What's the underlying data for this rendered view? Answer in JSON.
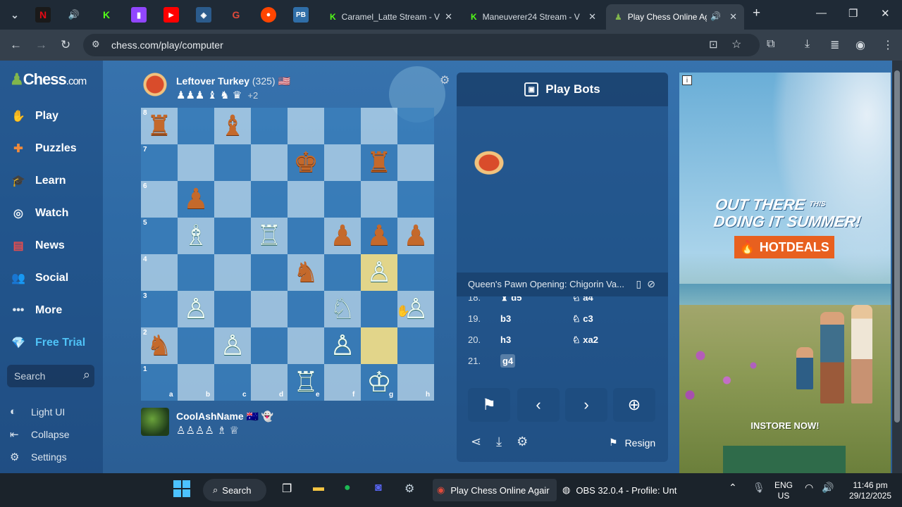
{
  "browser": {
    "tabs": [
      {
        "title": "Caramel_Latte Stream - V"
      },
      {
        "title": "Maneuverer24 Stream - V"
      },
      {
        "title": "Play Chess Online Ag"
      }
    ],
    "url": "chess.com/play/computer"
  },
  "sidebar": {
    "logo_text": "Chess",
    "logo_suffix": ".com",
    "items": [
      {
        "label": "Play"
      },
      {
        "label": "Puzzles"
      },
      {
        "label": "Learn"
      },
      {
        "label": "Watch"
      },
      {
        "label": "News"
      },
      {
        "label": "Social"
      },
      {
        "label": "More"
      },
      {
        "label": "Free Trial"
      }
    ],
    "search_placeholder": "Search",
    "bottom": [
      {
        "label": "Light UI"
      },
      {
        "label": "Collapse"
      },
      {
        "label": "Settings"
      }
    ]
  },
  "opponent": {
    "name": "Leftover Turkey",
    "rating": "(325)",
    "flag": "🇺🇸",
    "captured": "♟♟♟ ♝ ♞ ♛",
    "advantage": "+2"
  },
  "player": {
    "name": "CoolAshName",
    "flag": "🇦🇺",
    "captured": "♙♙♙♙ ♗ ♕"
  },
  "board": {
    "files": [
      "a",
      "b",
      "c",
      "d",
      "e",
      "f",
      "g",
      "h"
    ],
    "ranks": [
      "8",
      "7",
      "6",
      "5",
      "4",
      "3",
      "2",
      "1"
    ],
    "highlight": [
      "g4",
      "g2"
    ],
    "pieces": [
      {
        "sq": "a8",
        "p": "♜",
        "c": "b"
      },
      {
        "sq": "c8",
        "p": "♝",
        "c": "b"
      },
      {
        "sq": "e7",
        "p": "♚",
        "c": "b"
      },
      {
        "sq": "g7",
        "p": "♜",
        "c": "b"
      },
      {
        "sq": "b6",
        "p": "♟",
        "c": "b"
      },
      {
        "sq": "b5",
        "p": "♗",
        "c": "w"
      },
      {
        "sq": "d5",
        "p": "♖",
        "c": "w"
      },
      {
        "sq": "f5",
        "p": "♟",
        "c": "b"
      },
      {
        "sq": "g5",
        "p": "♟",
        "c": "b"
      },
      {
        "sq": "h5",
        "p": "♟",
        "c": "b"
      },
      {
        "sq": "e4",
        "p": "♞",
        "c": "b"
      },
      {
        "sq": "g4",
        "p": "♙",
        "c": "w"
      },
      {
        "sq": "b3",
        "p": "♙",
        "c": "w"
      },
      {
        "sq": "f3",
        "p": "♘",
        "c": "w"
      },
      {
        "sq": "h3",
        "p": "♙",
        "c": "w"
      },
      {
        "sq": "a2",
        "p": "♞",
        "c": "b"
      },
      {
        "sq": "c2",
        "p": "♙",
        "c": "w"
      },
      {
        "sq": "f2",
        "p": "♙",
        "c": "w"
      },
      {
        "sq": "e1",
        "p": "♖",
        "c": "w"
      },
      {
        "sq": "g1",
        "p": "♔",
        "c": "w"
      }
    ]
  },
  "panel": {
    "title": "Play Bots",
    "opening": "Queen's Pawn Opening: Chigorin Va...",
    "moves": [
      {
        "num": "18.",
        "white": "♝ d5",
        "black": "♘ a4"
      },
      {
        "num": "19.",
        "white": "b3",
        "black": "♘ c3"
      },
      {
        "num": "20.",
        "white": "h3",
        "black": "♘ xa2"
      },
      {
        "num": "21.",
        "white": "g4",
        "black": ""
      }
    ],
    "resign_label": "Resign"
  },
  "ad": {
    "line1": "OUT THERE",
    "this": "THIS",
    "line2": "DOING IT",
    "summer": "SUMMER!",
    "badge": "HOTDEALS",
    "instore": "INSTORE NOW!"
  },
  "taskbar": {
    "search": "Search",
    "app_chess": "Play Chess Online Agair",
    "app_obs": "OBS 32.0.4 - Profile: Unt",
    "lang1": "ENG",
    "lang2": "US",
    "time": "11:46 pm",
    "date": "29/12/2025"
  }
}
